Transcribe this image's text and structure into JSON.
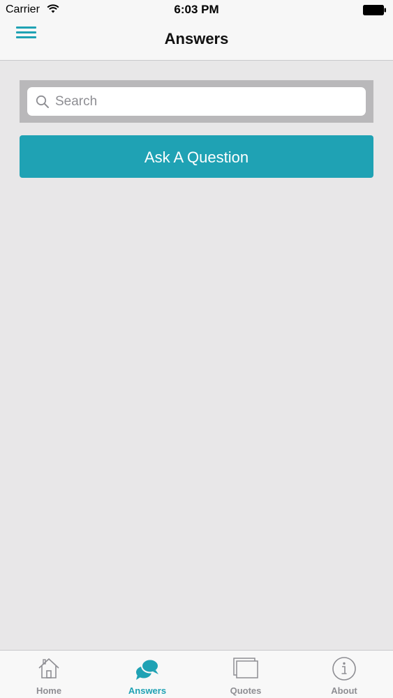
{
  "status_bar": {
    "carrier": "Carrier",
    "time": "6:03 PM"
  },
  "nav": {
    "title": "Answers"
  },
  "search": {
    "placeholder": "Search",
    "value": ""
  },
  "ask_button": {
    "label": "Ask A Question"
  },
  "tabs": [
    {
      "label": "Home",
      "icon": "home-icon",
      "active": false
    },
    {
      "label": "Answers",
      "icon": "chat-bubbles-icon",
      "active": true
    },
    {
      "label": "Quotes",
      "icon": "quotes-icon",
      "active": false
    },
    {
      "label": "About",
      "icon": "info-icon",
      "active": false
    }
  ],
  "colors": {
    "accent": "#1fa2b4",
    "background": "#e8e7e8",
    "search_frame": "#b9b8ba",
    "tab_inactive": "#8e8e93"
  }
}
